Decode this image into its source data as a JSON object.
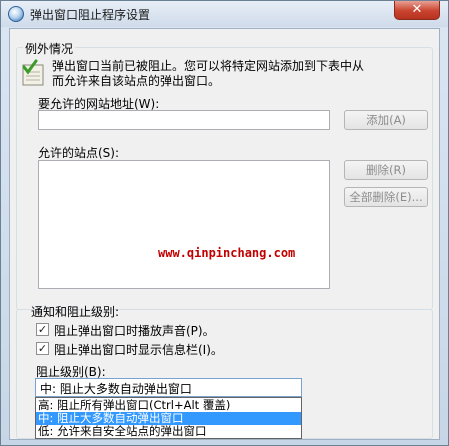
{
  "window": {
    "title": "弹出窗口阻止程序设置",
    "close_label": "✕"
  },
  "exceptions": {
    "legend": "例外情况",
    "info_text": "弹出窗口当前已被阻止。您可以将特定网站添加到下表中从而允许来自该站点的弹出窗口。",
    "address_label": "要允许的网站地址(W):",
    "address_value": "",
    "add_button": "添加(A)",
    "allowed_label": "允许的站点(S):",
    "allowed_sites": [],
    "remove_button": "删除(R)",
    "remove_all_button": "全部删除(E)...",
    "watermark": "www.qinpinchang.com"
  },
  "notification": {
    "legend": "通知和阻止级别:",
    "play_sound": {
      "label": "阻止弹出窗口时播放声音(P)。",
      "checked": true
    },
    "show_infobar": {
      "label": "阻止弹出窗口时显示信息栏(I)。",
      "checked": true
    },
    "level_label": "阻止级别(B):",
    "level_selected": "中: 阻止大多数自动弹出窗口",
    "level_options": [
      "高: 阻止所有弹出窗口(Ctrl+Alt 覆盖)",
      "中: 阻止大多数自动弹出窗口",
      "低: 允许来自安全站点的弹出窗口"
    ],
    "highlighted_index": 1
  },
  "colors": {
    "selection": "#3399ff",
    "watermark": "#c10000",
    "close_button": "#c9432e"
  }
}
